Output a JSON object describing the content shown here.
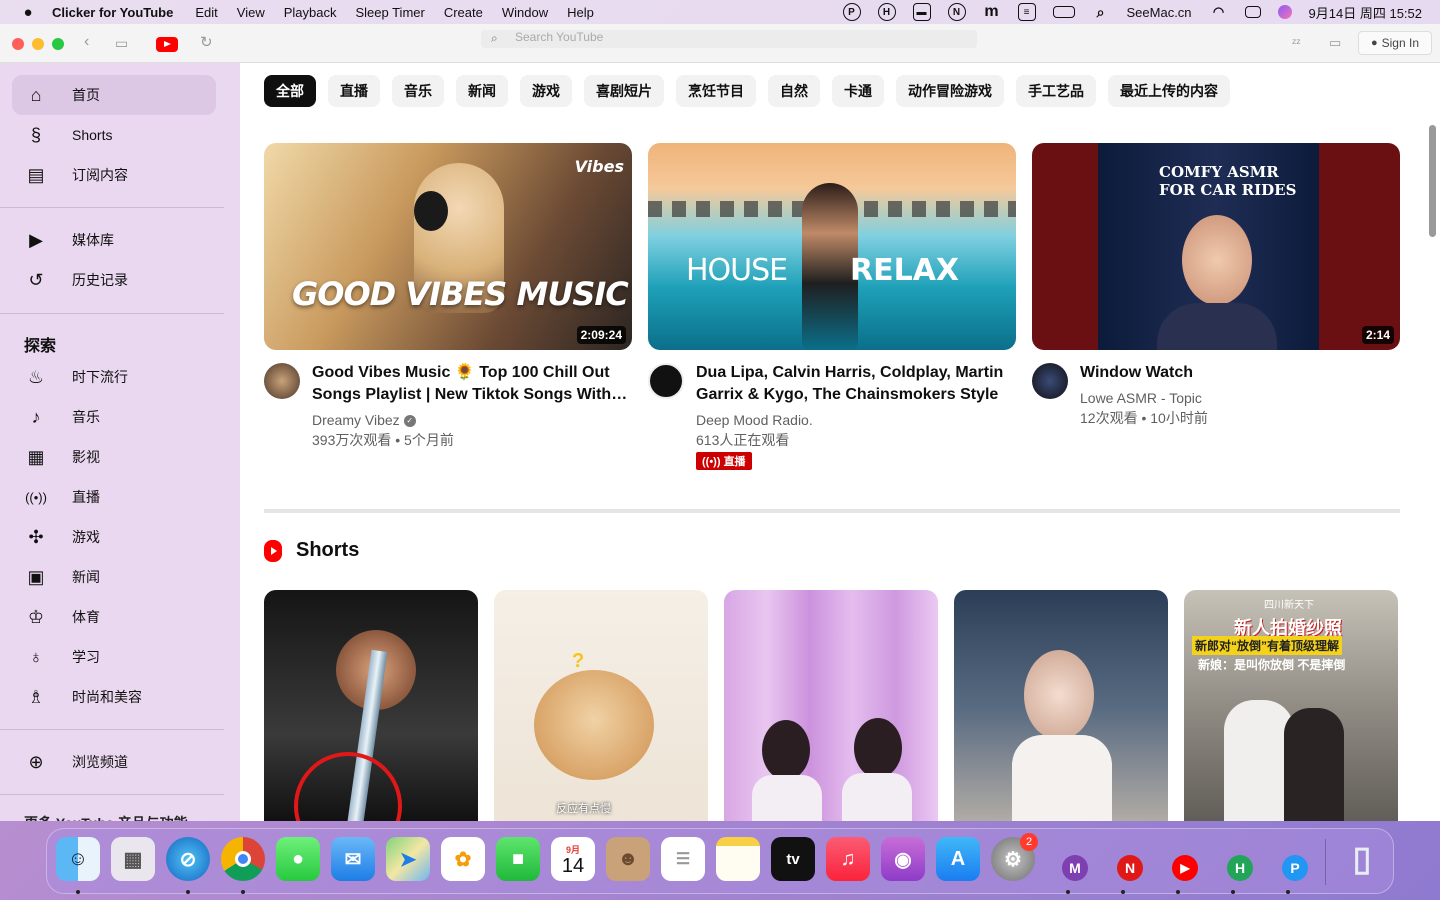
{
  "menubar": {
    "app_name": "Clicker for YouTube",
    "menus": [
      "Edit",
      "View",
      "Playback",
      "Sleep Timer",
      "Create",
      "Window",
      "Help"
    ],
    "status_letters": [
      "P",
      "H",
      "N",
      "m"
    ],
    "site": "SeeMac.cn",
    "clock": "9月14日 周四 15:52"
  },
  "toolbar": {
    "search_placeholder": "Search YouTube",
    "sign_in": "Sign In"
  },
  "sidebar": {
    "main_items": [
      {
        "label": "首页",
        "icon": "home-icon"
      },
      {
        "label": "Shorts",
        "icon": "shorts-icon"
      },
      {
        "label": "订阅内容",
        "icon": "subscriptions-icon"
      }
    ],
    "library_items": [
      {
        "label": "媒体库",
        "icon": "library-icon"
      },
      {
        "label": "历史记录",
        "icon": "history-icon"
      }
    ],
    "explore_title": "探索",
    "explore_items": [
      {
        "label": "时下流行",
        "icon": "trending-icon"
      },
      {
        "label": "音乐",
        "icon": "music-icon"
      },
      {
        "label": "影视",
        "icon": "movies-icon"
      },
      {
        "label": "直播",
        "icon": "live-icon"
      },
      {
        "label": "游戏",
        "icon": "gaming-icon"
      },
      {
        "label": "新闻",
        "icon": "news-icon"
      },
      {
        "label": "体育",
        "icon": "sports-icon"
      },
      {
        "label": "学习",
        "icon": "learning-icon"
      },
      {
        "label": "时尚和美容",
        "icon": "fashion-icon"
      }
    ],
    "browse_channels": "浏览频道",
    "more_title": "更多 YouTube 产品与功能"
  },
  "chips": [
    "全部",
    "直播",
    "音乐",
    "新闻",
    "游戏",
    "喜剧短片",
    "烹饪节目",
    "自然",
    "卡通",
    "动作冒险游戏",
    "手工艺品",
    "最近上传的内容"
  ],
  "videos": [
    {
      "thumb_text": "GOOD VIBES MUSIC",
      "thumb_logo": "Vibes",
      "duration": "2:09:24",
      "title": "Good Vibes Music 🌻 Top 100 Chill Out Songs Playlist | New Tiktok Songs With…",
      "channel": "Dreamy Vibez",
      "stats": "393万次观看 • 5个月前"
    },
    {
      "thumb_text_left": "HOUSE",
      "thumb_text_right": "RELAX",
      "title": "Dua Lipa, Calvin Harris, Coldplay, Martin Garrix & Kygo, The Chainsmokers Style …",
      "channel": "Deep Mood Radio.",
      "stats": "613人正在观看",
      "live_label": "直播"
    },
    {
      "thumb_text_line1": "COMFY ASMR",
      "thumb_text_line2": "FOR CAR RIDES",
      "duration": "2:14",
      "title": "Window Watch",
      "channel": "Lowe ASMR - Topic",
      "stats": "12次观看 • 10小时前"
    }
  ],
  "shorts": {
    "title": "Shorts",
    "items": [
      {
        "caption": ""
      },
      {
        "caption": "反应有点慢",
        "mark": "?"
      },
      {
        "caption": ""
      },
      {
        "caption": ""
      },
      {
        "header": "四川新天下",
        "headline": "新人拍婚纱照",
        "line2": "新郎对“放倒”有着顶级理解",
        "line3": "新娘：是叫你放倒 不是摔倒"
      }
    ]
  },
  "dock": {
    "apps": [
      "Finder",
      "Launchpad",
      "Safari",
      "Chrome",
      "Messages",
      "Mail",
      "Maps",
      "Photos",
      "FaceTime",
      "Calendar",
      "Contacts",
      "Reminders",
      "Notes",
      "TV",
      "Music",
      "Podcasts",
      "App Store",
      "System Settings",
      "Clicker M",
      "Clicker N",
      "Clicker YouTube",
      "Clicker H",
      "Clicker P",
      "Trash"
    ],
    "calendar_month": "9月",
    "calendar_day": "14",
    "settings_badge": "2",
    "tv_label": "tv",
    "clicker_letters": [
      "M",
      "N",
      "",
      "H",
      "P"
    ]
  },
  "colors": {
    "sidebar_bg": "#e9d8ef",
    "accent_red": "#ff0000",
    "chip_active": "#0f0f0f"
  }
}
